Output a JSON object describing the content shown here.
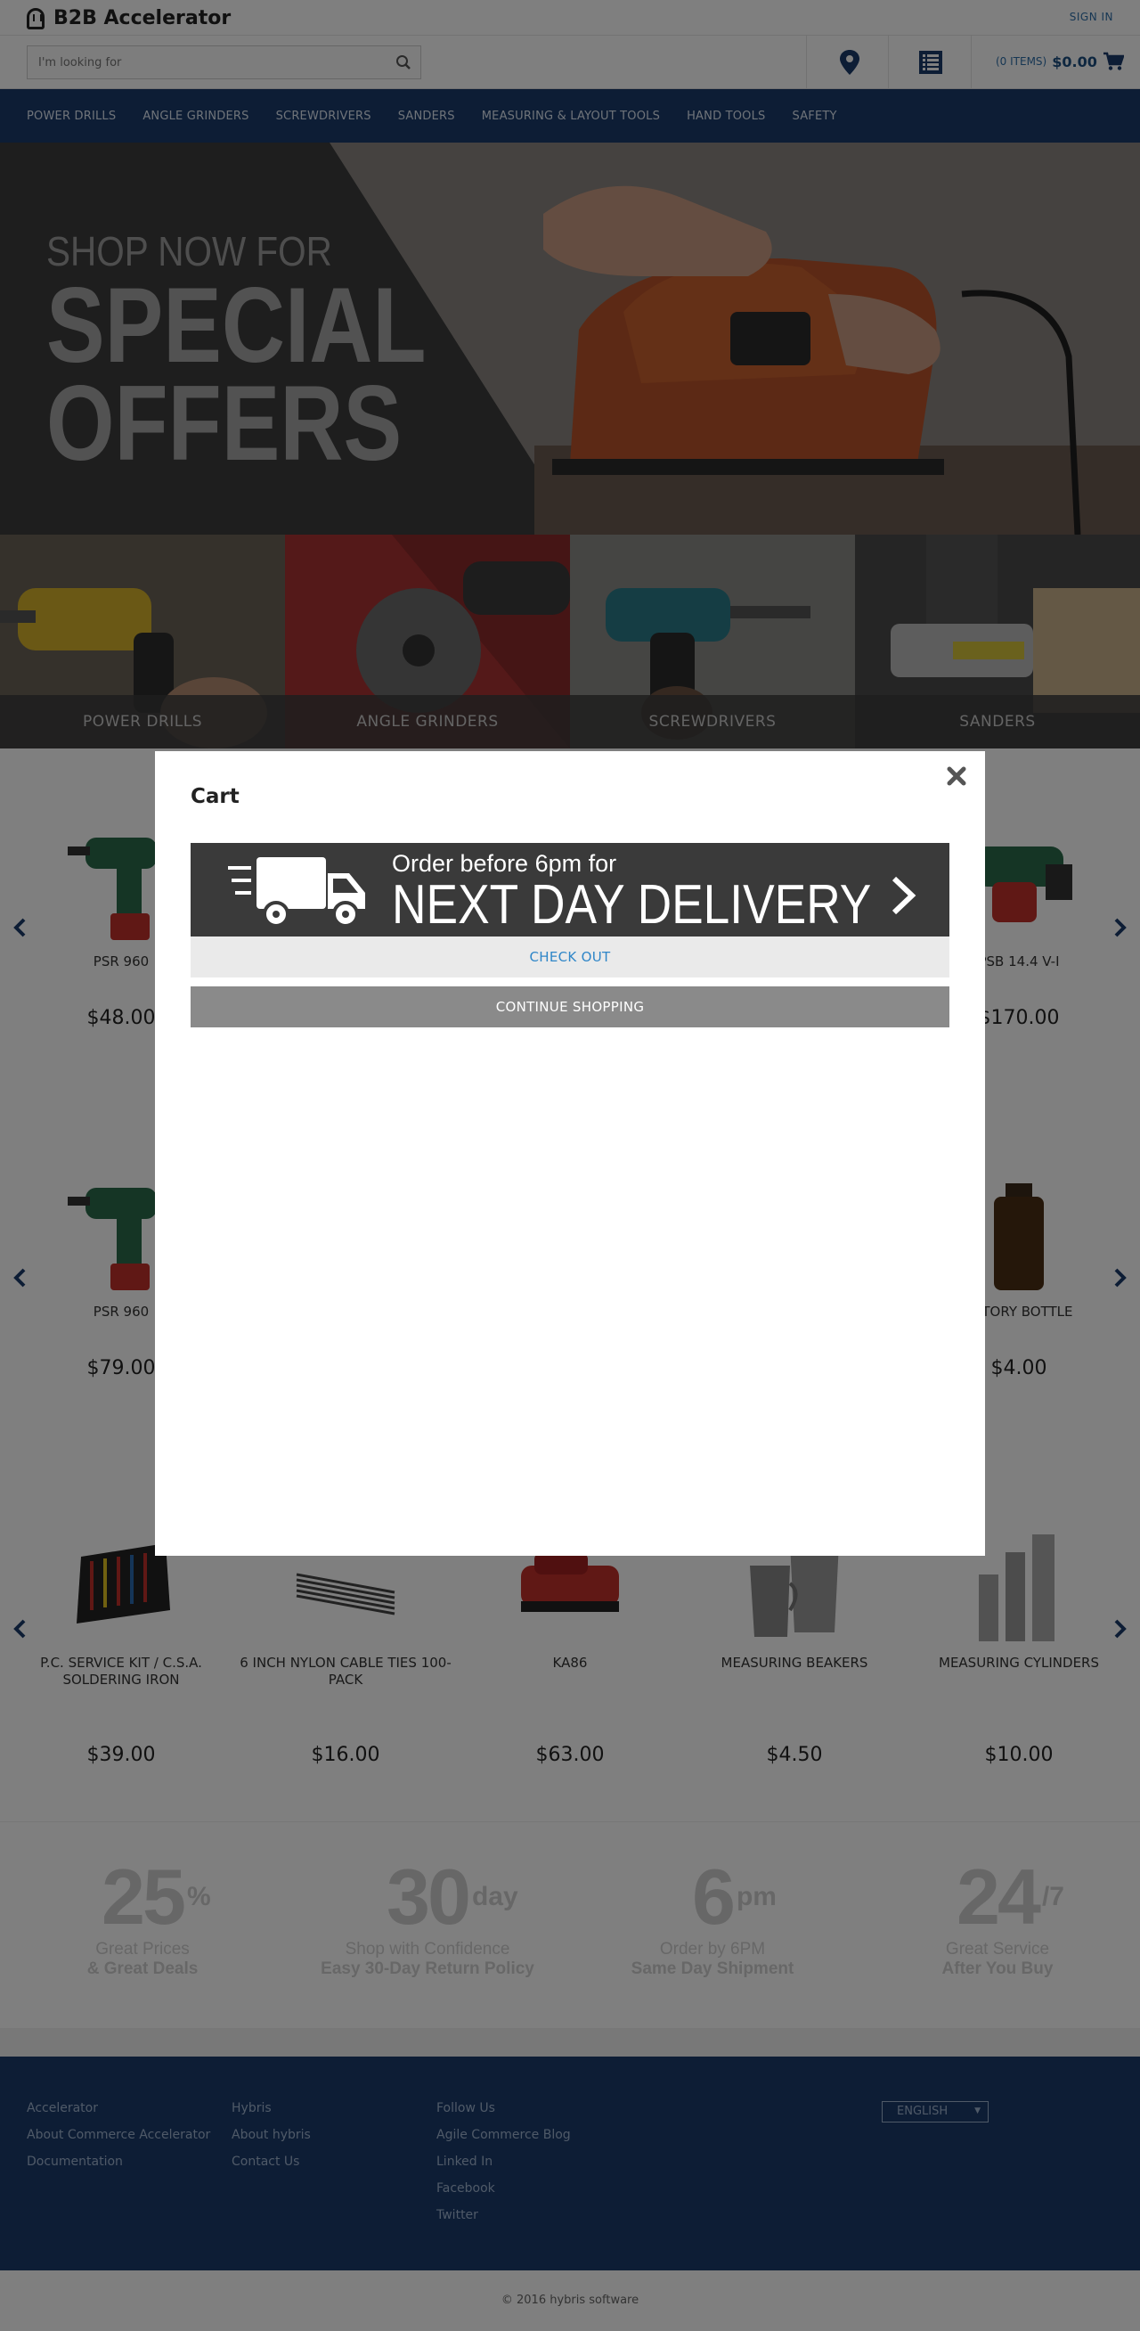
{
  "header": {
    "logo_text": "B2B Accelerator",
    "signin_label": "SIGN IN",
    "search_placeholder": "I'm looking for",
    "cart_items": "(0 ITEMS)",
    "cart_total": "$0.00"
  },
  "nav": {
    "items": [
      "POWER DRILLS",
      "ANGLE GRINDERS",
      "SCREWDRIVERS",
      "SANDERS",
      "MEASURING & LAYOUT TOOLS",
      "HAND TOOLS",
      "SAFETY"
    ]
  },
  "hero": {
    "line1": "SHOP NOW FOR",
    "line2": "SPECIAL",
    "line3": "OFFERS"
  },
  "categories": [
    "POWER DRILLS",
    "ANGLE GRINDERS",
    "SCREWDRIVERS",
    "SANDERS"
  ],
  "products": {
    "row1": [
      {
        "name": "PSR 960",
        "price": "$48.00"
      },
      {
        "name": "PSB 14.4 V-I",
        "price": "$170.00"
      }
    ],
    "row2": [
      {
        "name": "PSR 960",
        "price": "$79.00"
      },
      {
        "name": "RATORY BOTTLE",
        "price": "$4.00"
      }
    ],
    "row3": [
      {
        "name": "P.C. SERVICE KIT / C.S.A. SOLDERING IRON",
        "price": "$39.00"
      },
      {
        "name": "6 INCH NYLON CABLE TIES 100-PACK",
        "price": "$16.00"
      },
      {
        "name": "KA86",
        "price": "$63.00"
      },
      {
        "name": "MEASURING BEAKERS",
        "price": "$4.50"
      },
      {
        "name": "MEASURING CYLINDERS",
        "price": "$10.00"
      }
    ]
  },
  "stats": [
    {
      "num": "25",
      "sup": "%",
      "line1": "Great Prices",
      "line2": "& Great Deals"
    },
    {
      "num": "30",
      "sup": "day",
      "line1": "Shop with Confidence",
      "line2": "Easy 30-Day Return Policy"
    },
    {
      "num": "6",
      "sup": "pm",
      "line1": "Order by 6PM",
      "line2": "Same Day Shipment"
    },
    {
      "num": "24",
      "sup": "/7",
      "line1": "Great Service",
      "line2": "After You Buy"
    }
  ],
  "footer": {
    "col1": [
      "Accelerator",
      "About Commerce Accelerator",
      "Documentation"
    ],
    "col2": [
      "Hybris",
      "About hybris",
      "Contact Us"
    ],
    "col3": [
      "Follow Us",
      "Agile Commerce Blog",
      "Linked In",
      "Facebook",
      "Twitter"
    ],
    "language": "ENGLISH",
    "copyright": "© 2016 hybris software"
  },
  "modal": {
    "title": "Cart",
    "banner_small": "Order before 6pm for",
    "banner_big": "NEXT DAY DELIVERY",
    "checkout_label": "CHECK OUT",
    "continue_label": "CONTINUE SHOPPING"
  },
  "colors": {
    "nav_bg": "#1b3a6b",
    "link_blue": "#2f6fa8",
    "checkout_text": "#2f86c8",
    "continue_bg": "#8a8a8a"
  }
}
